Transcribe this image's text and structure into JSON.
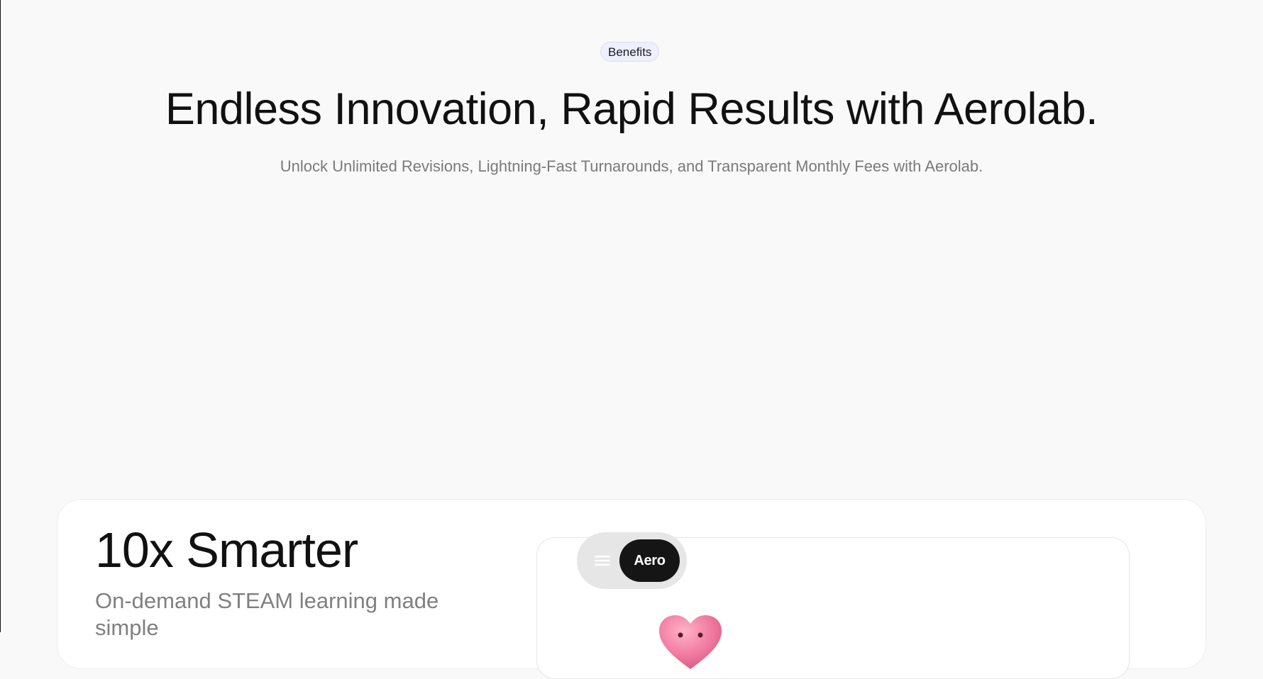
{
  "benefits_badge": "Benefits",
  "headline": "Endless Innovation, Rapid Results with Aerolab.",
  "subheadline": "Unlock Unlimited Revisions, Lightning-Fast Turnarounds, and Transparent Monthly Fees with Aerolab.",
  "feature_card": {
    "title": "10x Smarter",
    "subtitle": "On-demand STEAM learning made simple"
  },
  "preview": {
    "menu_icon": "hamburger-menu-icon",
    "brand_button_label": "Aero",
    "sticker_icon": "heart-sticker-icon"
  },
  "colors": {
    "background": "#f9f9f9",
    "badge_bg": "#eef0fb",
    "text_primary": "#111111",
    "text_muted": "#7a7a7a",
    "pill_bg": "#e6e6e6",
    "aero_button_bg": "#151515",
    "heart": "#f07aa0"
  }
}
